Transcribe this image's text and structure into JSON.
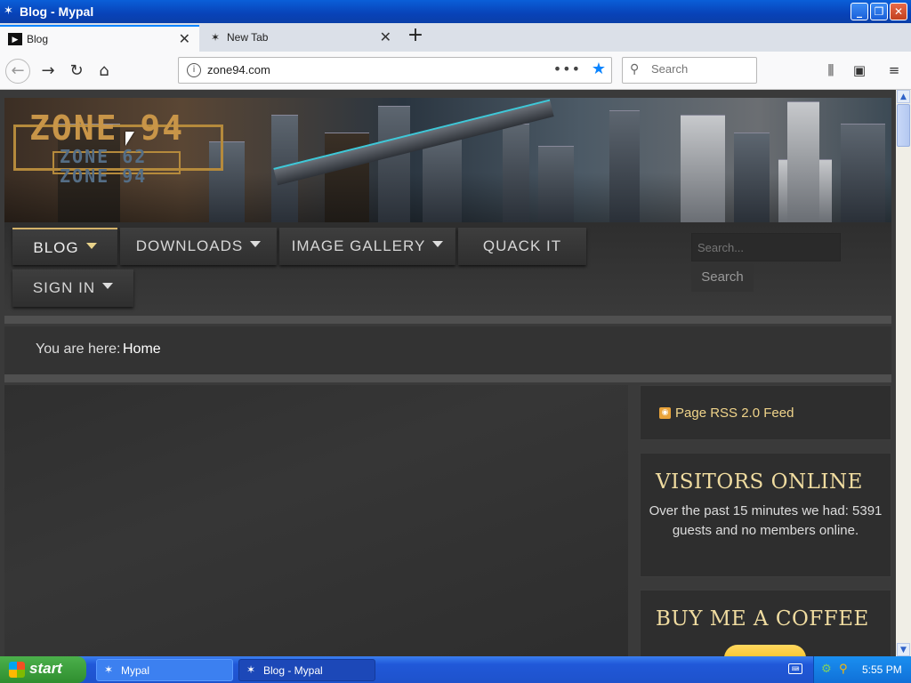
{
  "window": {
    "title": "Blog - Mypal",
    "app_icon": "mypal-icon",
    "buttons": [
      "_",
      "❐",
      "✕"
    ]
  },
  "tabs": [
    {
      "label": "Blog",
      "icon": "blog-favicon",
      "icon_glyph": "▶",
      "active": true
    },
    {
      "label": "New Tab",
      "icon": "mypal-favicon",
      "icon_glyph": "✶",
      "active": false
    }
  ],
  "navbar": {
    "url": "zone94.com",
    "search_placeholder": "Search"
  },
  "site": {
    "logo": {
      "main": "ZONE 94",
      "sub1": "ZONE 62",
      "sub2": "ZONE 94"
    },
    "menu": [
      {
        "label": "BLOG",
        "dropdown": true,
        "active": true
      },
      {
        "label": "DOWNLOADS",
        "dropdown": true,
        "active": false
      },
      {
        "label": "IMAGE GALLERY",
        "dropdown": true,
        "active": false
      },
      {
        "label": "QUACK IT",
        "dropdown": false,
        "active": false
      },
      {
        "label": "SIGN IN",
        "dropdown": true,
        "active": false
      }
    ],
    "search": {
      "placeholder": "Search...",
      "button": "Search"
    },
    "breadcrumb": {
      "label": "You are here:",
      "current": "Home"
    },
    "sidebar": {
      "rss": "Page RSS 2.0 Feed",
      "visitors_heading": "VISITORS ONLINE",
      "visitors_text": "Over the past 15 minutes we had: 5391 guests and no members online.",
      "coffee_heading": "BUY ME A COFFEE"
    }
  },
  "taskbar": {
    "start": "start",
    "items": [
      {
        "label": "Mypal",
        "active": false
      },
      {
        "label": "Blog - Mypal",
        "active": true
      }
    ],
    "clock": "5:55 PM"
  },
  "colors": {
    "accent_gold": "#f0dca0",
    "link_gold": "#f0d48a",
    "page_bg": "#3a3a3a",
    "xp_blue": "#0a5fd8"
  }
}
